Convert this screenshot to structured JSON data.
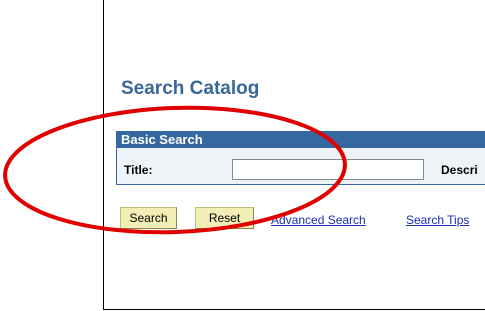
{
  "page": {
    "title": "Search Catalog"
  },
  "basic_search": {
    "header": "Basic Search",
    "title_label": "Title:",
    "title_value": "",
    "description_label": "Descri"
  },
  "actions": {
    "search_label": "Search",
    "reset_label": "Reset",
    "advanced_link": "Advanced Search",
    "tips_link": "Search Tips"
  },
  "colors": {
    "title_text": "#3a6899",
    "panel_header": "#3468a1",
    "button_fill": "#f3eeb5",
    "link": "#1a2fb5",
    "annotation": "#e00000"
  }
}
